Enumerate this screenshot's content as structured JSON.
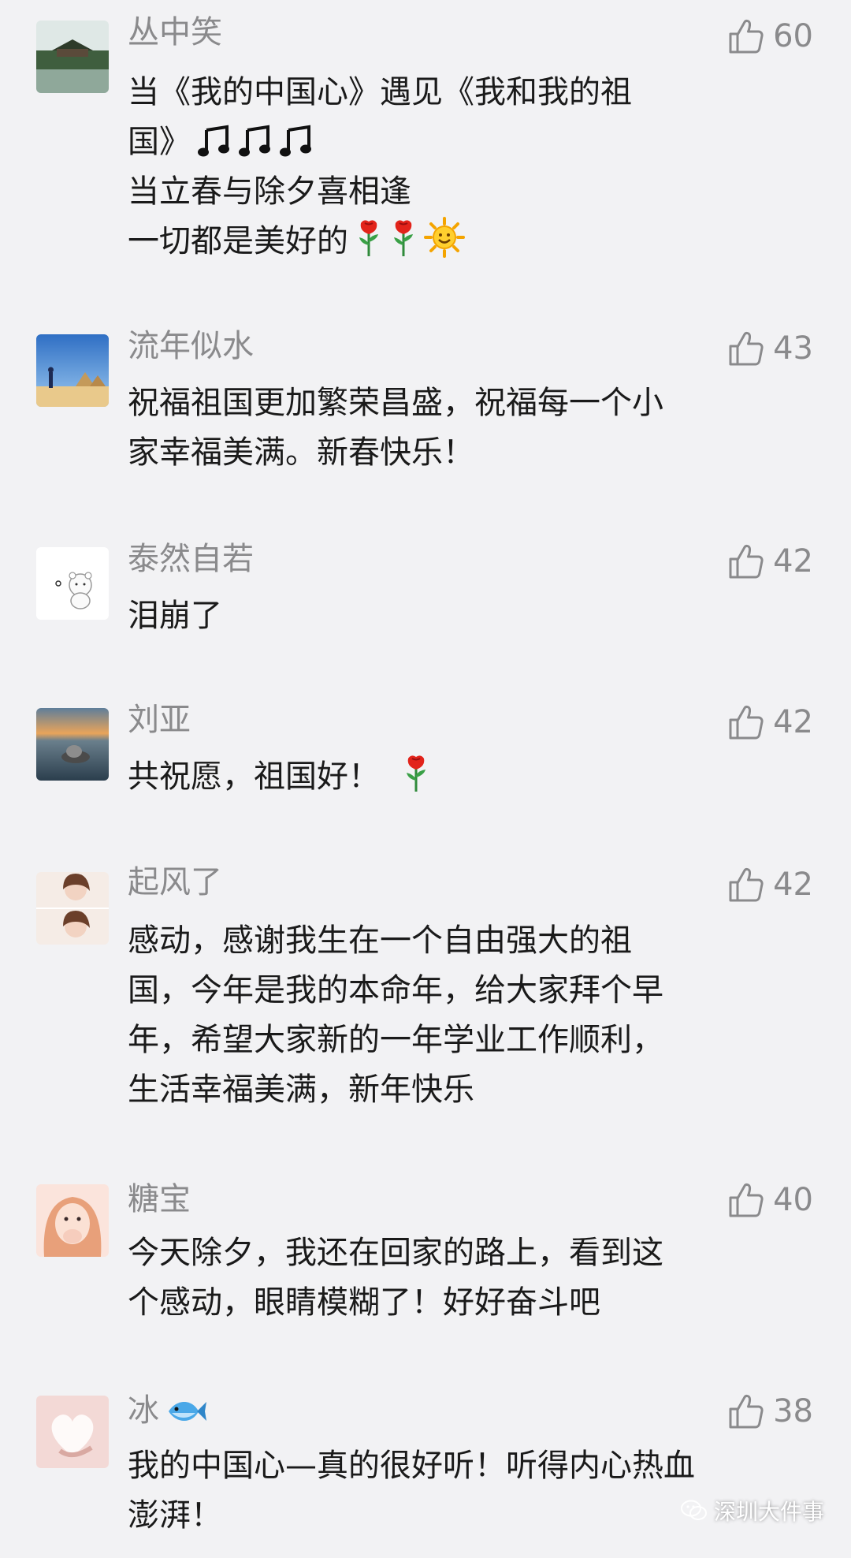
{
  "comments": [
    {
      "name": "丛中笑",
      "likes": "60",
      "lines": [
        "当《我的中国心》遇见《我和我的祖",
        "国》",
        "当立春与除夕喜相逢",
        "一切都是美好的"
      ]
    },
    {
      "name": "流年似水",
      "likes": "43",
      "lines": [
        "祝福祖国更加繁荣昌盛，祝福每一个小",
        "家幸福美满。新春快乐！"
      ]
    },
    {
      "name": "泰然自若",
      "likes": "42",
      "lines": [
        "泪崩了"
      ]
    },
    {
      "name": "刘亚",
      "likes": "42",
      "lines": [
        "共祝愿，祖国好！"
      ]
    },
    {
      "name": "起风了",
      "likes": "42",
      "lines": [
        "感动，感谢我生在一个自由强大的祖",
        "国，今年是我的本命年，给大家拜个早",
        "年，希望大家新的一年学业工作顺利，",
        "生活幸福美满，新年快乐"
      ]
    },
    {
      "name": "糖宝",
      "likes": "40",
      "lines": [
        "今天除夕，我还在回家的路上，看到这",
        "个感动，眼睛模糊了！好好奋斗吧"
      ]
    },
    {
      "name": "冰",
      "likes": "38",
      "lines": [
        "我的中国心—真的很好听！听得内心热血",
        "澎湃！"
      ]
    }
  ],
  "watermark": "深圳大件事",
  "icons": {
    "like": "thumbs-up-icon",
    "music": "music-note-icon",
    "rose": "rose-icon",
    "sun": "sun-icon",
    "fish": "fish-icon"
  },
  "colors": {
    "background": "#f2f2f4",
    "name_text": "#8a8a8c",
    "content_text": "#1a1a1a",
    "like_icon": "#8a8a8c"
  }
}
